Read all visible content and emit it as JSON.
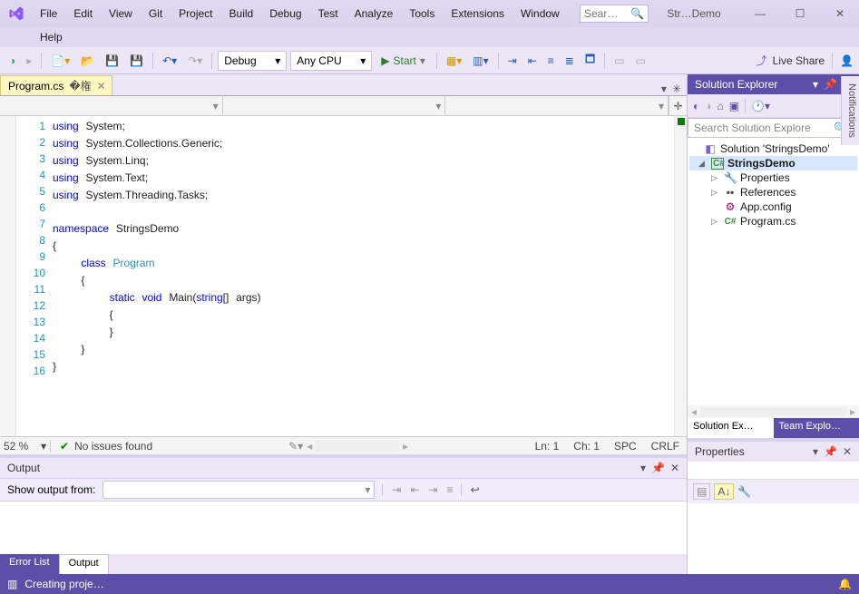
{
  "menu": [
    "File",
    "Edit",
    "View",
    "Git",
    "Project",
    "Build",
    "Debug",
    "Test",
    "Analyze",
    "Tools",
    "Extensions",
    "Window",
    "Help"
  ],
  "title_search_placeholder": "Sear…",
  "project_title": "Str…Demo",
  "toolbar": {
    "config": "Debug",
    "platform": "Any CPU",
    "start": "Start",
    "liveshare": "Live Share"
  },
  "doc_tab": {
    "name": "Program.cs"
  },
  "code": {
    "lines": [
      1,
      2,
      3,
      4,
      5,
      6,
      7,
      8,
      9,
      10,
      11,
      12,
      13,
      14,
      15,
      16
    ]
  },
  "editor_status": {
    "zoom": "52 %",
    "issues": "No issues found",
    "ln": "Ln: 1",
    "ch": "Ch: 1",
    "spc": "SPC",
    "crlf": "CRLF"
  },
  "output": {
    "title": "Output",
    "show_from": "Show output from:"
  },
  "bottom_tabs": {
    "error_list": "Error List",
    "output": "Output"
  },
  "solution_explorer": {
    "title": "Solution Explorer",
    "search_placeholder": "Search Solution Explore",
    "solution": "Solution 'StringsDemo'",
    "project": "StringsDemo",
    "nodes": {
      "properties": "Properties",
      "references": "References",
      "appconfig": "App.config",
      "program": "Program.cs"
    },
    "tabs": {
      "sx": "Solution Ex…",
      "tx": "Team Explo…"
    }
  },
  "properties": {
    "title": "Properties"
  },
  "statusbar": {
    "text": "Creating proje…"
  },
  "notifications_tab": "Notifications"
}
